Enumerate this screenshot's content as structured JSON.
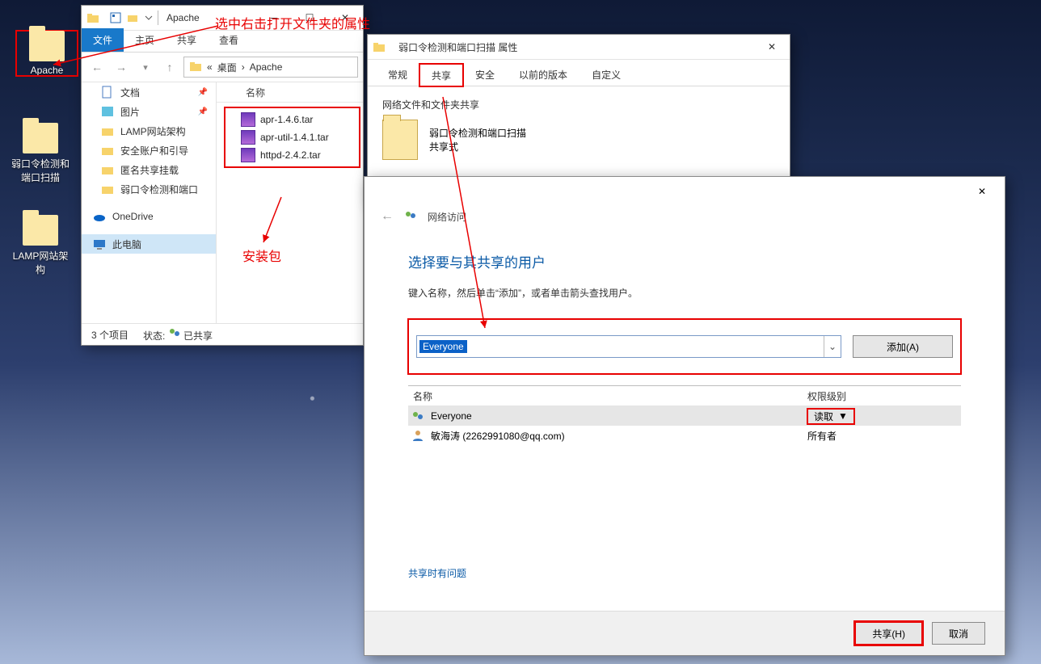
{
  "annotations": {
    "top_text": "选中右击打开文件夹的属性",
    "pkg_text": "安装包"
  },
  "desktop": {
    "icons": [
      {
        "label": "Apache"
      },
      {
        "label": "弱口令检测和端口扫描"
      },
      {
        "label": "LAMP网站架构"
      }
    ]
  },
  "explorer": {
    "title": "Apache",
    "tabs": {
      "file": "文件",
      "home": "主页",
      "share": "共享",
      "view": "查看"
    },
    "breadcrumb": {
      "seg1": "桌面",
      "seg2": "Apache"
    },
    "sidebar": {
      "items": [
        {
          "label": "文档",
          "kind": "doc",
          "pinned": true
        },
        {
          "label": "图片",
          "kind": "pic",
          "pinned": true
        },
        {
          "label": "LAMP网站架构",
          "kind": "folder"
        },
        {
          "label": "安全账户和引导",
          "kind": "folder"
        },
        {
          "label": "匿名共享挂载",
          "kind": "folder"
        },
        {
          "label": "弱口令检测和端口",
          "kind": "folder"
        }
      ],
      "onedrive": "OneDrive",
      "thispc": "此电脑"
    },
    "content": {
      "col_name": "名称",
      "files": [
        "apr-1.4.6.tar",
        "apr-util-1.4.1.tar",
        "httpd-2.4.2.tar"
      ]
    },
    "status": {
      "count": "3 个项目",
      "state_label": "状态:",
      "state": "已共享"
    }
  },
  "props": {
    "title": "弱口令检测和端口扫描 属性",
    "tabs": {
      "general": "常规",
      "share": "共享",
      "security": "安全",
      "versions": "以前的版本",
      "custom": "自定义"
    },
    "group": "网络文件和文件夹共享",
    "name": "弱口令检测和端口扫描",
    "mode": "共享式"
  },
  "netdlg": {
    "nav_title": "网络访问",
    "heading": "选择要与其共享的用户",
    "hint": "键入名称，然后单击“添加”，或者单击箭头查找用户。",
    "combo_value": "Everyone",
    "add_btn": "添加(A)",
    "col_name": "名称",
    "col_level": "权限级别",
    "rows": [
      {
        "name": "Everyone",
        "level": "读取",
        "selected": true,
        "hasDrop": true,
        "icon": "group"
      },
      {
        "name": "敏海涛 (2262991080@qq.com)",
        "level": "所有者",
        "selected": false,
        "hasDrop": false,
        "icon": "user"
      }
    ],
    "trouble": "共享时有问题",
    "share_btn": "共享(H)",
    "cancel_btn": "取消"
  }
}
